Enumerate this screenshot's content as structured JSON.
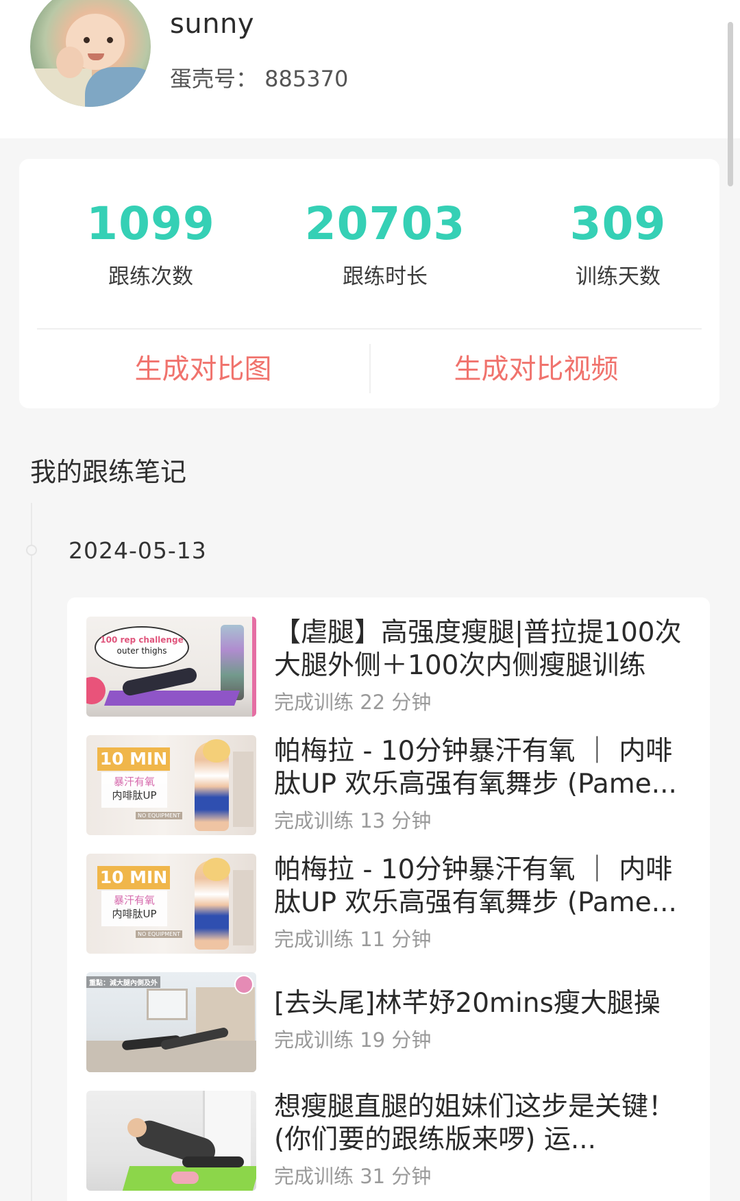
{
  "profile": {
    "username": "sunny",
    "egg_id": "蛋壳号：  885370"
  },
  "stats": [
    {
      "value": "1099",
      "label": "跟练次数"
    },
    {
      "value": "20703",
      "label": "跟练时长"
    },
    {
      "value": "309",
      "label": "训练天数"
    }
  ],
  "actions": {
    "compare_image": "生成对比图",
    "compare_video": "生成对比视频"
  },
  "notes": {
    "section_title": "我的跟练笔记",
    "date": "2024-05-13",
    "items": [
      {
        "title": "【虐腿】高强度瘦腿|普拉提100次大腿外侧＋100次内侧瘦腿训练",
        "subtitle": "完成训练 22 分钟",
        "thumb_text_1": "100 rep challenge",
        "thumb_text_2": "outer thighs"
      },
      {
        "title": "帕梅拉 - 10分钟暴汗有氧 ｜ 内啡肽UP 欢乐高强有氧舞步 (Pame...",
        "subtitle": "完成训练 13 分钟",
        "thumb_min": "10 MIN",
        "thumb_line_1": "暴汗有氧",
        "thumb_line_2": "内啡肽UP",
        "thumb_noeq": "NO EQUIPMENT"
      },
      {
        "title": "帕梅拉 - 10分钟暴汗有氧 ｜ 内啡肽UP 欢乐高强有氧舞步 (Pame...",
        "subtitle": "完成训练 11 分钟",
        "thumb_min": "10 MIN",
        "thumb_line_1": "暴汗有氧",
        "thumb_line_2": "内啡肽UP",
        "thumb_noeq": "NO EQUIPMENT"
      },
      {
        "title": "[去头尾]林芊妤20mins瘦大腿操",
        "subtitle": "完成训练 19 分钟",
        "thumb_banner": "重點：減大腿內側及外"
      },
      {
        "title": "想瘦腿直腿的姐妹们这步是关键！(你们要的跟练版来啰) 运...",
        "subtitle": "完成训练 31 分钟"
      }
    ]
  },
  "colors": {
    "accent": "#35d0b5",
    "action": "#f0736d",
    "background": "#f6f6f6"
  }
}
